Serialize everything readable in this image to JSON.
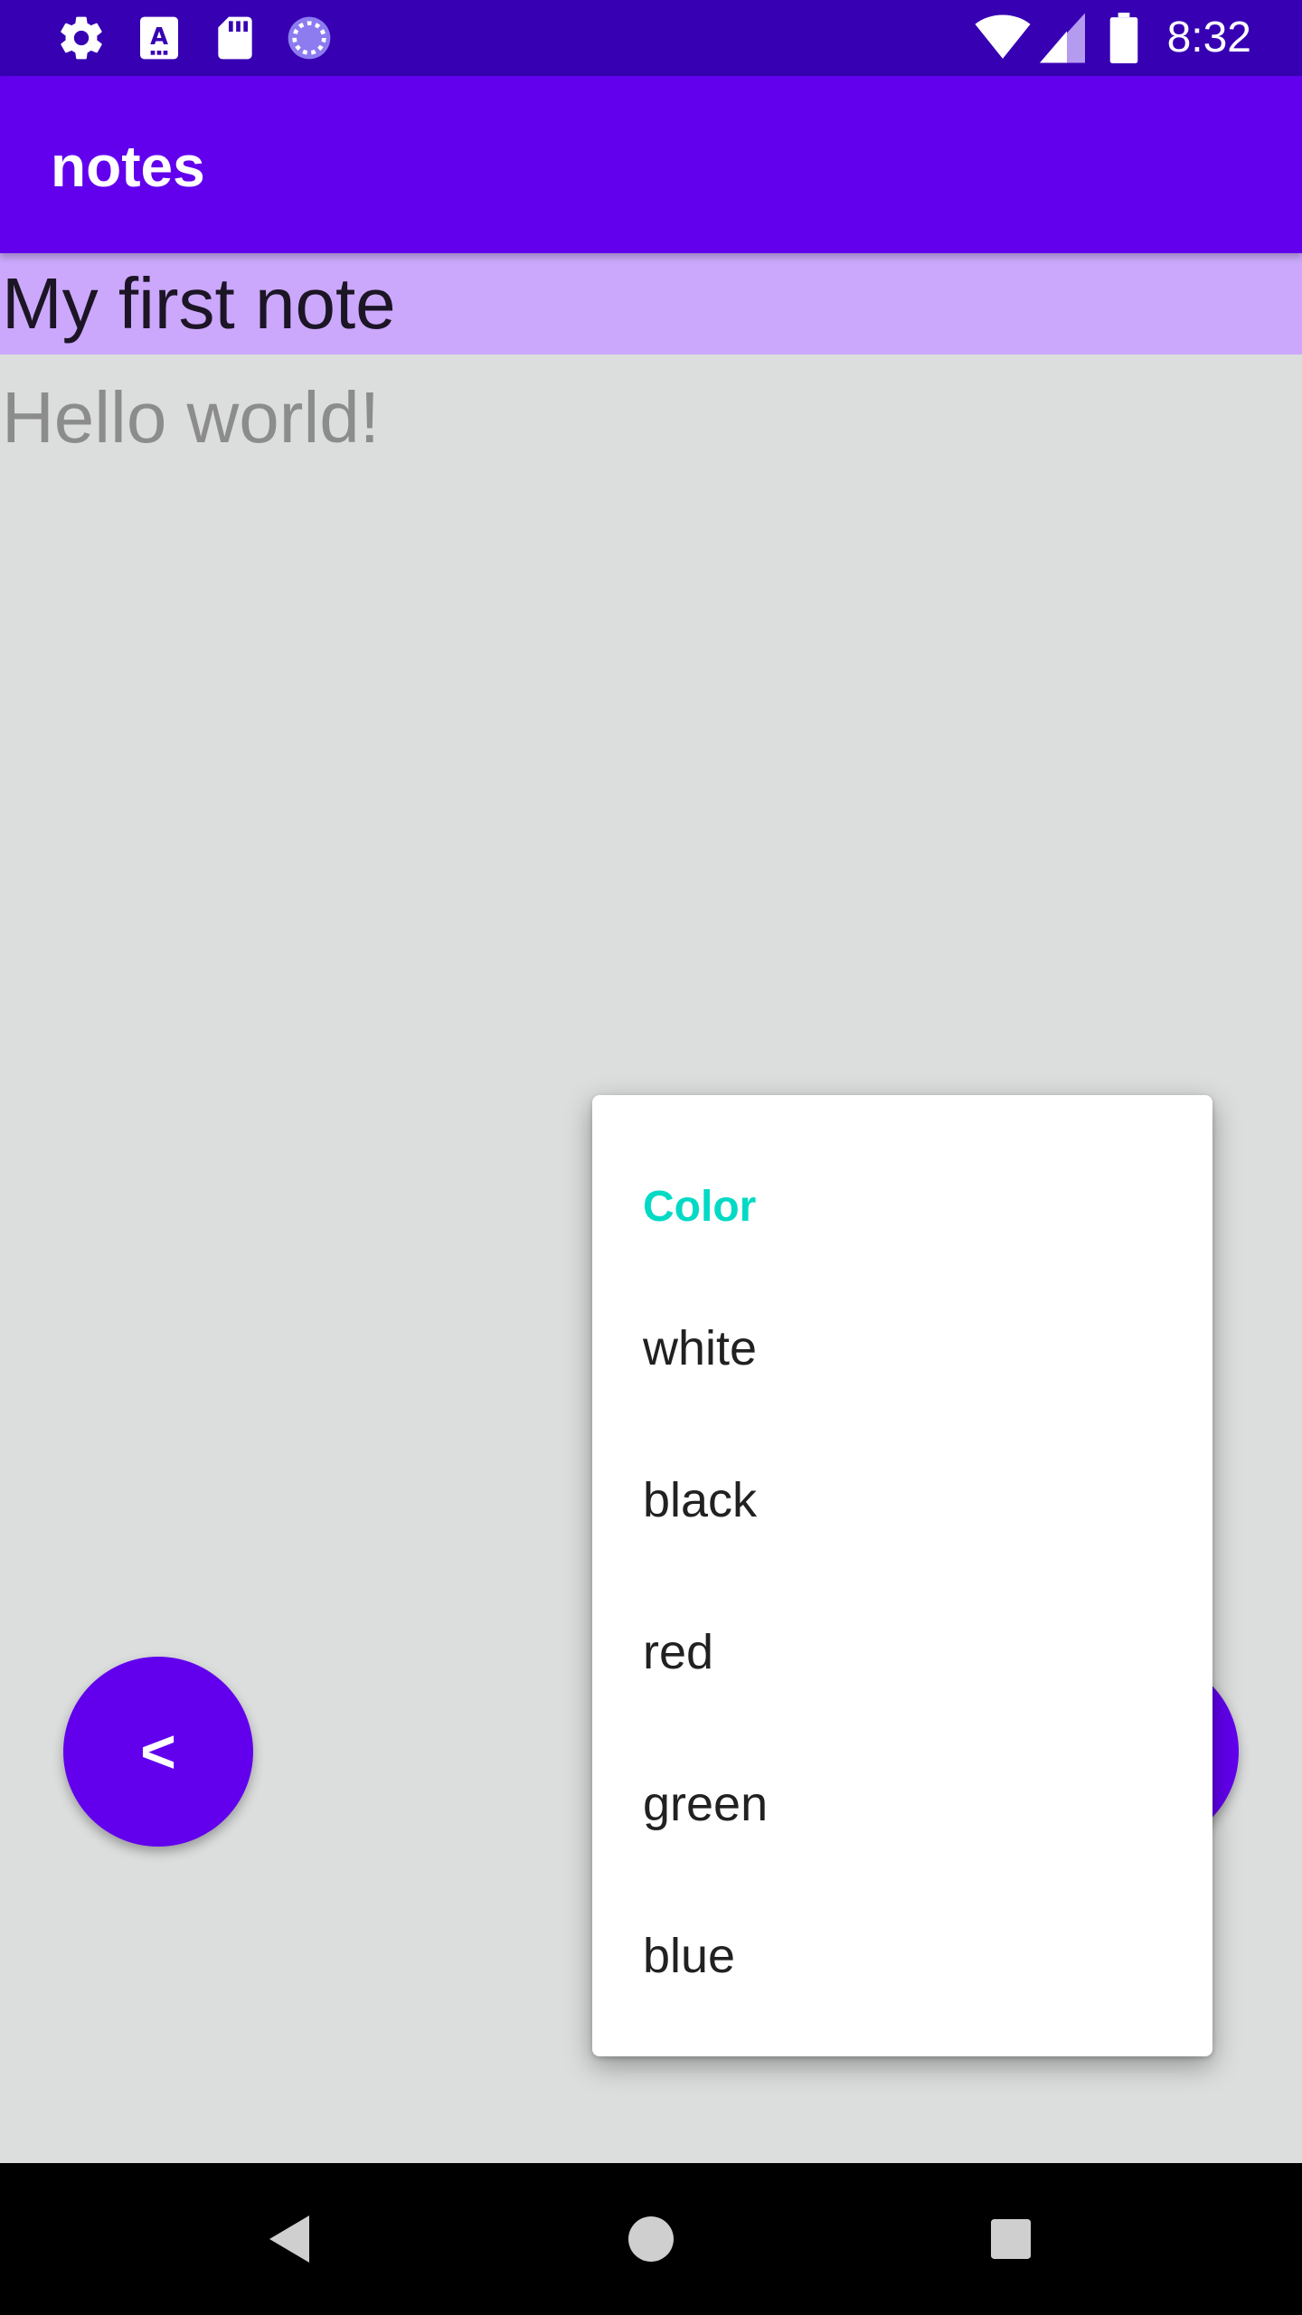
{
  "status_bar": {
    "time": "8:32",
    "left_icons": [
      "settings-icon",
      "keyboard-a-icon",
      "sd-card-icon",
      "sync-spinner-icon"
    ],
    "right_icons": [
      "wifi-icon",
      "signal-icon",
      "battery-icon"
    ]
  },
  "app_bar": {
    "title": "notes"
  },
  "note": {
    "title": "My first note",
    "body": "Hello world!",
    "title_bg_color": "#cba8fb"
  },
  "menu": {
    "header": "Color",
    "items": [
      "white",
      "black",
      "red",
      "green",
      "blue"
    ]
  },
  "fab": {
    "back_label": "<"
  },
  "nav_bar": {
    "icons": [
      "back-triangle-icon",
      "home-circle-icon",
      "recents-square-icon"
    ]
  },
  "colors": {
    "primary": "#6200ee",
    "primary_dark": "#3700b3",
    "accent": "#03dac5",
    "content_bg": "#dcdddd"
  }
}
